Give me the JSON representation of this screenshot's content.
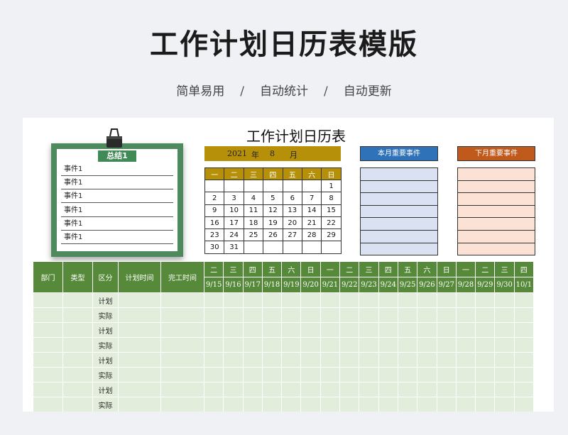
{
  "page": {
    "title": "工作计划日历表模版",
    "subtitle": [
      "简单易用",
      "自动统计",
      "自动更新"
    ],
    "separator": "/"
  },
  "summary": {
    "title": "总结1",
    "items": [
      "事件1",
      "事件1",
      "事件1",
      "事件1",
      "事件1",
      "事件1"
    ]
  },
  "calendar": {
    "title": "工作计划日历表",
    "year": "2021",
    "year_unit": "年",
    "month": "8",
    "month_unit": "月",
    "weekdays": [
      "一",
      "二",
      "三",
      "四",
      "五",
      "六",
      "日"
    ],
    "weeks": [
      [
        "",
        "",
        "",
        "",
        "",
        "",
        "1"
      ],
      [
        "2",
        "3",
        "4",
        "5",
        "6",
        "7",
        "8"
      ],
      [
        "9",
        "10",
        "11",
        "12",
        "13",
        "14",
        "15"
      ],
      [
        "16",
        "17",
        "18",
        "19",
        "20",
        "21",
        "22"
      ],
      [
        "23",
        "24",
        "25",
        "26",
        "27",
        "28",
        "29"
      ],
      [
        "30",
        "31",
        "",
        "",
        "",
        "",
        ""
      ]
    ]
  },
  "events": {
    "this_month": "本月重要事件",
    "next_month": "下月重要事件",
    "colors": {
      "this_month": "#2f72b8",
      "next_month": "#c05a1c",
      "calendar": "#b7900a",
      "grid_header": "#568a3a"
    }
  },
  "grid": {
    "headers": [
      "部门",
      "类型",
      "区分",
      "计划时间",
      "完工时间"
    ],
    "weekdays": [
      "二",
      "三",
      "四",
      "五",
      "六",
      "日",
      "一",
      "二",
      "三",
      "四",
      "五",
      "六",
      "日",
      "一",
      "二",
      "三",
      "四"
    ],
    "dates": [
      "9/15",
      "9/16",
      "9/17",
      "9/18",
      "9/19",
      "9/20",
      "9/21",
      "9/22",
      "9/23",
      "9/24",
      "9/25",
      "9/26",
      "9/27",
      "9/28",
      "9/29",
      "9/30",
      "10/1"
    ],
    "rows": [
      "计划",
      "实际",
      "计划",
      "实际",
      "计划",
      "实际",
      "计划",
      "实际"
    ]
  }
}
